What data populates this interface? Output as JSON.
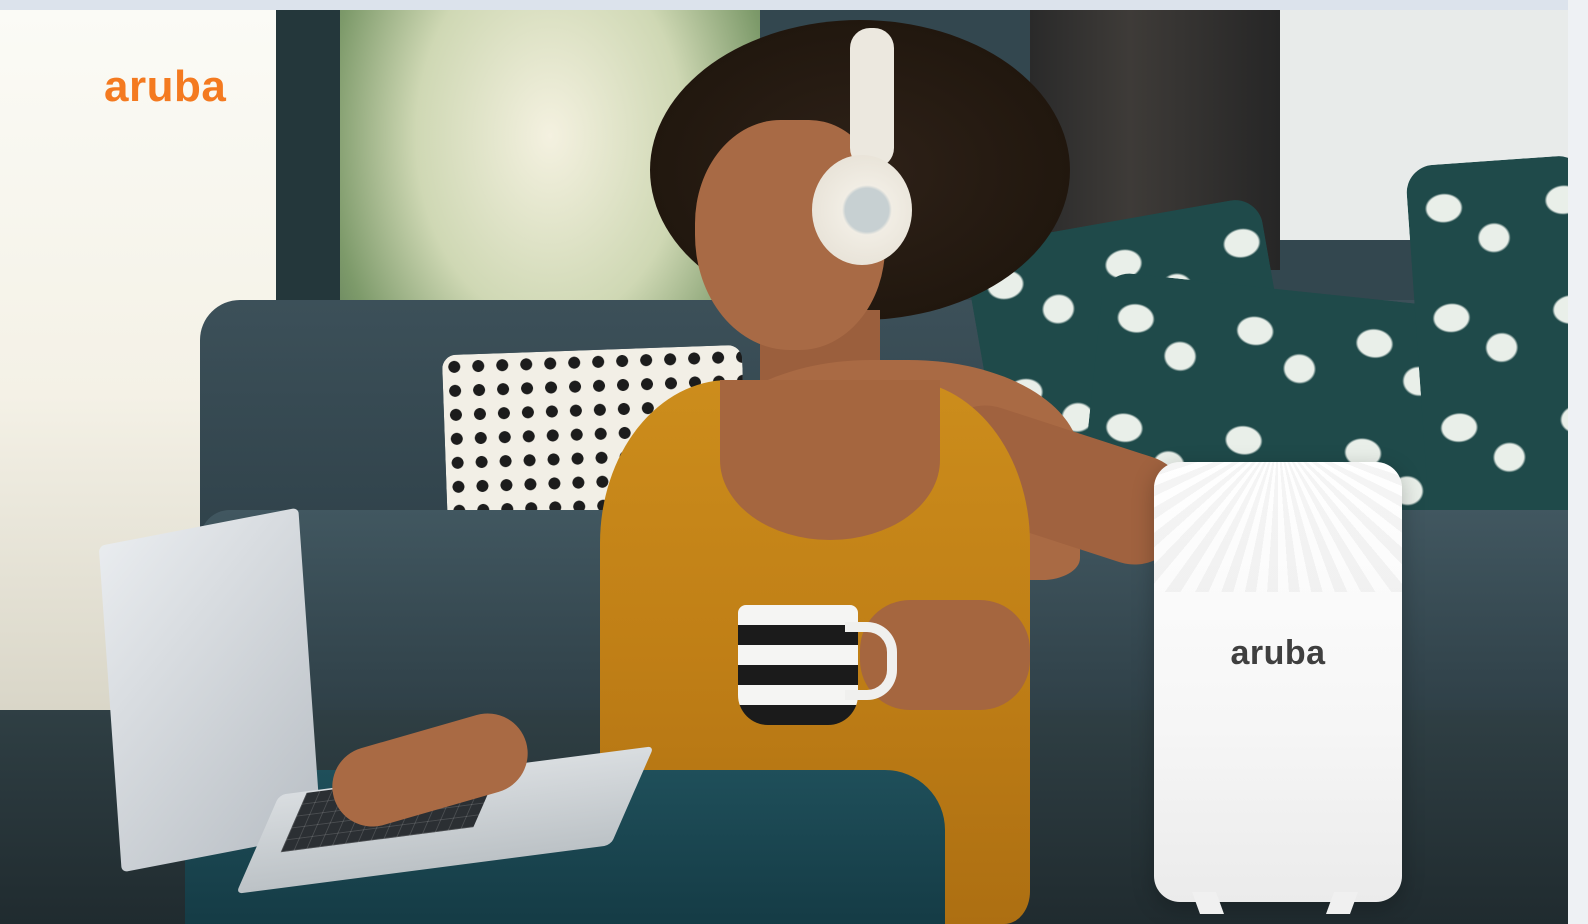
{
  "brand": {
    "logo_text": "aruba",
    "logo_color": "#f47a20"
  },
  "device": {
    "logo_text": "aruba",
    "body_color": "#ffffff"
  },
  "colors": {
    "top_strip": "#dce3ec",
    "shirt": "#c07f16",
    "sofa": "#33454d"
  }
}
